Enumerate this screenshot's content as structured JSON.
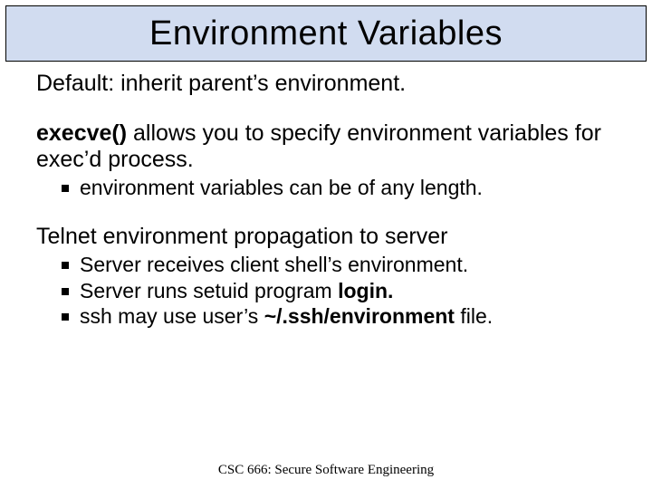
{
  "title": "Environment Variables",
  "para1": "Default: inherit parent’s environment.",
  "para2_pre_bold": "",
  "para2_bold": "execve()",
  "para2_post_bold": " allows you to specify environment variables for exec’d process.",
  "bullets_a": [
    "environment variables can be of any length."
  ],
  "para3": "Telnet environment propagation to server",
  "bullets_b": [
    {
      "pre": "Server receives client shell’s environment.",
      "bold": "",
      "post": ""
    },
    {
      "pre": "Server runs setuid program ",
      "bold": "login.",
      "post": ""
    },
    {
      "pre": "ssh may use user’s ",
      "bold": "~/.ssh/environment",
      "post": " file."
    }
  ],
  "footer": "CSC 666: Secure Software Engineering"
}
